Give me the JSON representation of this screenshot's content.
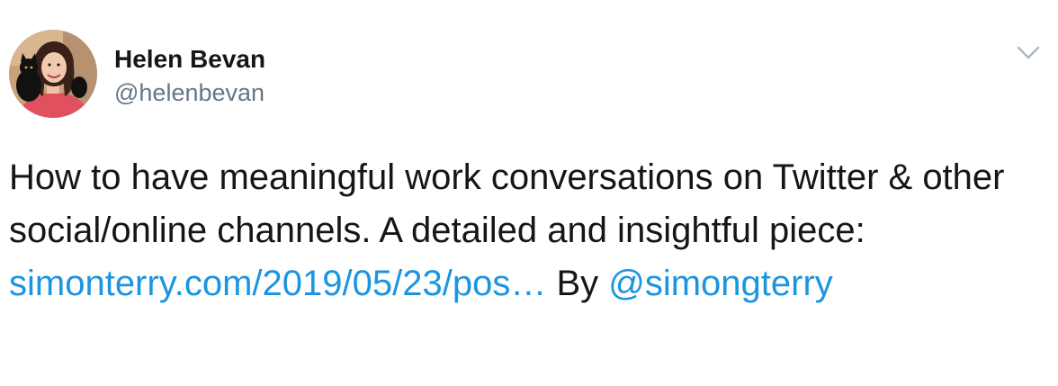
{
  "author": {
    "display_name": "Helen Bevan",
    "handle": "@helenbevan",
    "avatar_icon": "profile-photo-woman-with-black-cat"
  },
  "tweet": {
    "text_part1": "How to have meaningful work conversations on Twitter & other social/online channels. A detailed and insightful piece: ",
    "link_text": "simonterry.com/2019/05/23/pos…",
    "text_part2": " By ",
    "mention_text": "@simongterry"
  },
  "menu": {
    "icon": "chevron-down-icon"
  },
  "colors": {
    "text": "#14171a",
    "secondary_text": "#657786",
    "link": "#1b95e0",
    "chevron": "#aab8c2"
  }
}
